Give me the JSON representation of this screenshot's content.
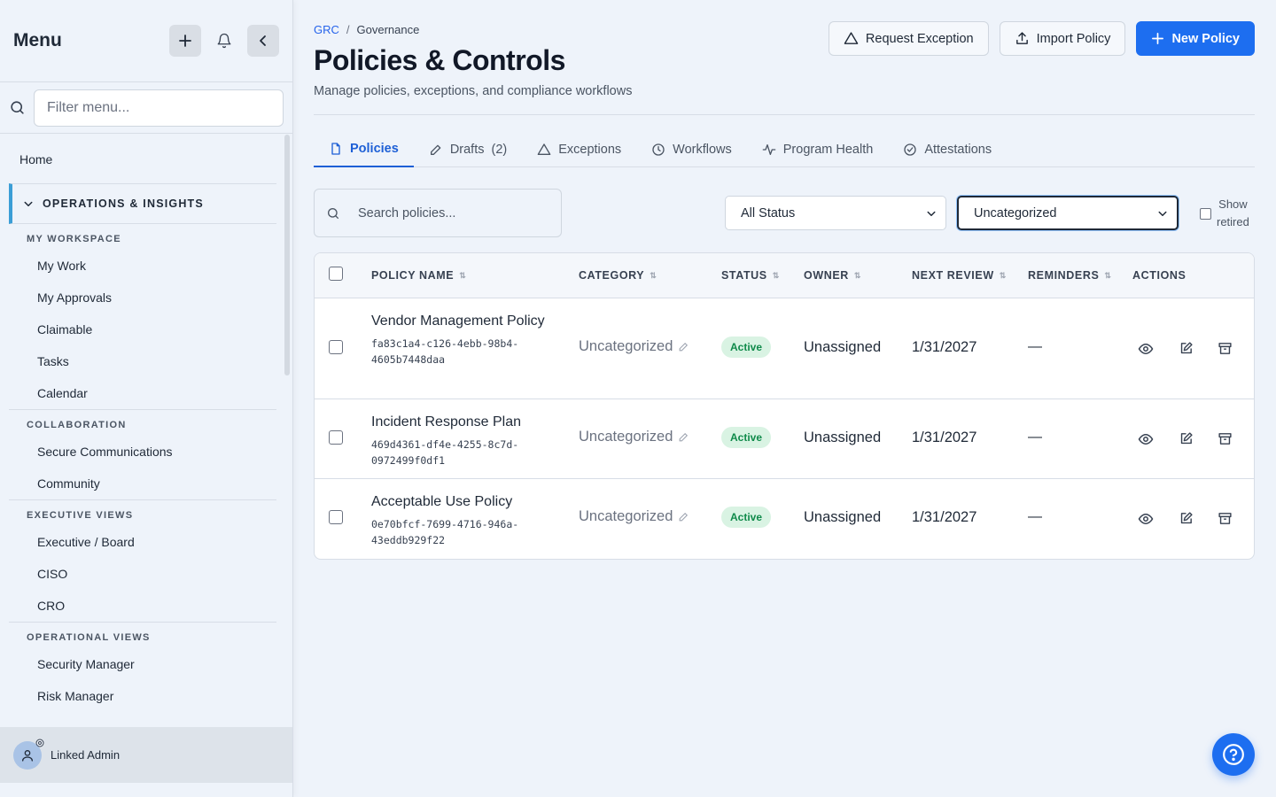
{
  "sidebar": {
    "title": "Menu",
    "filter_placeholder": "Filter menu...",
    "home": "Home",
    "group": "OPERATIONS & INSIGHTS",
    "sections": [
      {
        "title": "MY WORKSPACE",
        "items": [
          "My Work",
          "My Approvals",
          "Claimable",
          "Tasks",
          "Calendar"
        ]
      },
      {
        "title": "COLLABORATION",
        "items": [
          "Secure Communications",
          "Community"
        ]
      },
      {
        "title": "EXECUTIVE VIEWS",
        "items": [
          "Executive / Board",
          "CISO",
          "CRO"
        ]
      },
      {
        "title": "OPERATIONAL VIEWS",
        "items": [
          "Security Manager",
          "Risk Manager"
        ]
      }
    ],
    "user": "Linked Admin"
  },
  "breadcrumb": {
    "root": "GRC",
    "sep": "/",
    "current": "Governance"
  },
  "header": {
    "title": "Policies & Controls",
    "subtitle": "Manage policies, exceptions, and compliance workflows",
    "request_exception": "Request Exception",
    "import_policy": "Import Policy",
    "new_policy": "New Policy"
  },
  "tabs": {
    "policies": "Policies",
    "drafts": "Drafts",
    "drafts_count": "(2)",
    "exceptions": "Exceptions",
    "workflows": "Workflows",
    "program_health": "Program Health",
    "attestations": "Attestations"
  },
  "filters": {
    "search_placeholder": "Search policies...",
    "status": "All Status",
    "category": "Uncategorized",
    "show_retired_1": "Show",
    "show_retired_2": "retired"
  },
  "table": {
    "headers": {
      "policy_name": "POLICY NAME",
      "category": "CATEGORY",
      "status": "STATUS",
      "owner": "OWNER",
      "next_review": "NEXT REVIEW",
      "reminders": "REMINDERS",
      "actions": "ACTIONS"
    },
    "rows": [
      {
        "name": "Vendor Management Policy",
        "id": "fa83c1a4-c126-4ebb-98b4-4605b7448daa",
        "category": "Uncategorized",
        "status": "Active",
        "owner": "Unassigned",
        "review": "1/31/2027",
        "reminders": "—"
      },
      {
        "name": "Incident Response Plan",
        "id": "469d4361-df4e-4255-8c7d-0972499f0df1",
        "category": "Uncategorized",
        "status": "Active",
        "owner": "Unassigned",
        "review": "1/31/2027",
        "reminders": "—"
      },
      {
        "name": "Acceptable Use Policy",
        "id": "0e70bfcf-7699-4716-946a-43eddb929f22",
        "category": "Uncategorized",
        "status": "Active",
        "owner": "Unassigned",
        "review": "1/31/2027",
        "reminders": "—"
      }
    ]
  },
  "colors": {
    "accent": "#1d6ef0",
    "active_badge": "#0f8a4a",
    "sidebar_marker": "#3b9ed6"
  }
}
